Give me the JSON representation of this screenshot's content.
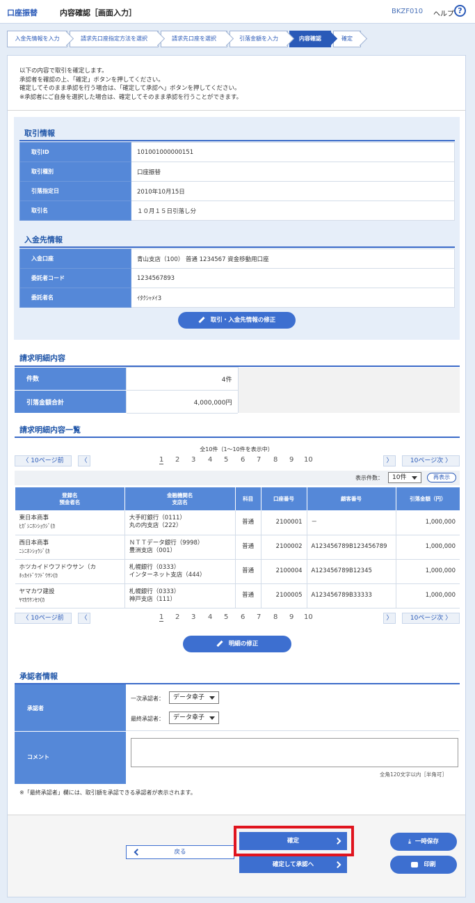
{
  "header": {
    "service": "口座振替",
    "title": "内容確認［画面入力］",
    "screen_code": "BKZF010",
    "help": "ヘルプ",
    "help_icon": "?"
  },
  "steps": [
    {
      "label": "入金先情報を入力"
    },
    {
      "label": "請求先口座指定方法を選択"
    },
    {
      "label": "請求先口座を選択"
    },
    {
      "label": "引落金額を入力"
    },
    {
      "label": "内容確認"
    },
    {
      "label": "確定"
    }
  ],
  "intro": [
    "以下の内容で取引を確定します。",
    "承認者を確認の上、「確定」ボタンを押してください。",
    "確定してそのまま承認を行う場合は、「確定して承認へ」ボタンを押してください。",
    "※承認者にご自身を選択した場合は、確定してそのまま承認を行うことができます。"
  ],
  "transaction": {
    "heading": "取引情報",
    "rows": [
      {
        "label": "取引ID",
        "value": "101001000000151"
      },
      {
        "label": "取引種別",
        "value": "口座振替"
      },
      {
        "label": "引落指定日",
        "value": "2010年10月15日"
      },
      {
        "label": "取引名",
        "value": "１０月１５日引落し分"
      }
    ]
  },
  "deposit": {
    "heading": "入金先情報",
    "rows": [
      {
        "label": "入金口座",
        "value": "青山支店（100） 普通 1234567 資金移動用口座"
      },
      {
        "label": "委託者コード",
        "value": "1234567893"
      },
      {
        "label": "委託者名",
        "value": "ｲﾀｸｼｬﾒｲ3"
      }
    ],
    "edit_button": "取引・入金先情報の修正"
  },
  "summary": {
    "heading": "請求明細内容",
    "count_label": "件数",
    "count_value": "4件",
    "total_label": "引落金額合計",
    "total_value": "4,000,000円"
  },
  "list": {
    "heading": "請求明細内容一覧",
    "range": "全10件（1～10件を表示中）",
    "prev": "10ページ前",
    "next": "10ページ次",
    "pages": [
      "1",
      "2",
      "3",
      "4",
      "5",
      "6",
      "7",
      "8",
      "9",
      "10"
    ],
    "per_page_label": "表示件数：",
    "per_page_value": "10件",
    "redisplay": "再表示",
    "columns": [
      "登録名",
      "預金者名",
      "金融機関名",
      "支店名",
      "科目",
      "口座番号",
      "顧客番号",
      "引落金額（円）"
    ],
    "rows": [
      {
        "name": "東日本商事",
        "kana": "ﾋｶﾞｼﾆﾎﾝｼｮｳｼﾞ(ｶ",
        "bank": "大手町銀行（0111）",
        "branch": "丸の内支店（222）",
        "type": "普通",
        "account": "2100001",
        "customer": "－",
        "amount": "1,000,000"
      },
      {
        "name": "西日本商事",
        "kana": "ﾆｼﾆﾎﾝｼｮｳｼﾞ(ｶ",
        "bank": "ＮＴＴデータ銀行（9998）",
        "branch": "豊洲支店（001）",
        "type": "普通",
        "account": "2100002",
        "customer": "A123456789B123456789",
        "amount": "1,000,000"
      },
      {
        "name": "ホツカイドウフドウサン（カ",
        "kana": "ﾎｯｶｲﾄﾞｳﾌﾄﾞｳｻﾝ(ｶ",
        "bank": "札幌銀行（0333）",
        "branch": "インターネット支店（444）",
        "type": "普通",
        "account": "2100004",
        "customer": "A123456789B12345",
        "amount": "1,000,000"
      },
      {
        "name": "ヤマカワ建設",
        "kana": "ﾔﾏｶﾜｹﾝｾﾂ(ｶ",
        "bank": "札幌銀行（0333）",
        "branch": "神戸支店（111）",
        "type": "普通",
        "account": "2100005",
        "customer": "A123456789B33333",
        "amount": "1,000,000"
      }
    ],
    "edit_button": "明細の修正"
  },
  "approver": {
    "heading": "承認者情報",
    "approver_label": "承認者",
    "first_label": "一次承認者：",
    "first_value": "データ幸子",
    "final_label": "最終承認者：",
    "final_value": "データ幸子",
    "comment_label": "コメント",
    "comment_hint": "全角120文字以内［半角可］",
    "note": "※「最終承認者」欄には、取引額を承認できる承認者が表示されます。"
  },
  "actions": {
    "confirm": "確定",
    "confirm_approve": "確定して承認へ",
    "back": "戻る",
    "save": "一時保存",
    "print": "印刷"
  },
  "colors": {
    "accent": "#3d6fd0",
    "header_cell": "#5588d8",
    "highlight": "#e0141e"
  }
}
